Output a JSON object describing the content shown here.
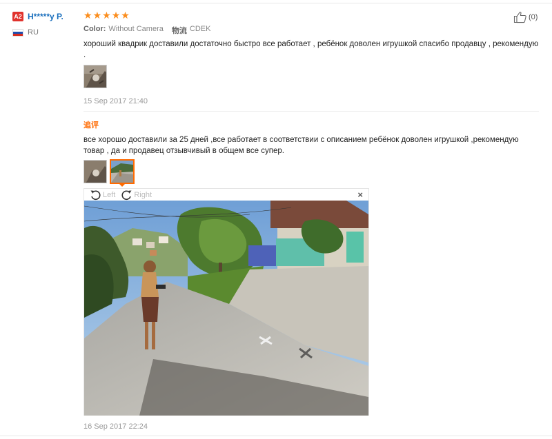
{
  "user": {
    "level": "A2",
    "name": "H*****y P.",
    "country": "RU"
  },
  "review": {
    "rating": 5,
    "stars": [
      "★",
      "★",
      "★",
      "★",
      "★"
    ],
    "color_key": "Color:",
    "color_value": "Without Camera",
    "logistics_key": "物流",
    "logistics_value": "CDEK",
    "text": "хороший квадрик доставили достаточно быстро все работает , ребёнок доволен игрушкой спасибо продавцу , рекомендую .",
    "date": "15 Sep 2017 21:40"
  },
  "additional": {
    "label": "追评",
    "text": "все хорошо доставили за 25 дней ,все работает в соответствии с описанием ребёнок доволен игрушкой ,рекомендую товар , да и продавец отзывчивый в общем все супер.",
    "date": "16 Sep 2017 22:24"
  },
  "helpful": {
    "count": "(0)"
  },
  "viewer": {
    "rotate_left": "Left",
    "rotate_right": "Right",
    "close": "×"
  },
  "colors": {
    "accent": "#ff6a00",
    "star": "#fb8d1d",
    "name": "#1a6fbd",
    "badge": "#e0332d"
  }
}
